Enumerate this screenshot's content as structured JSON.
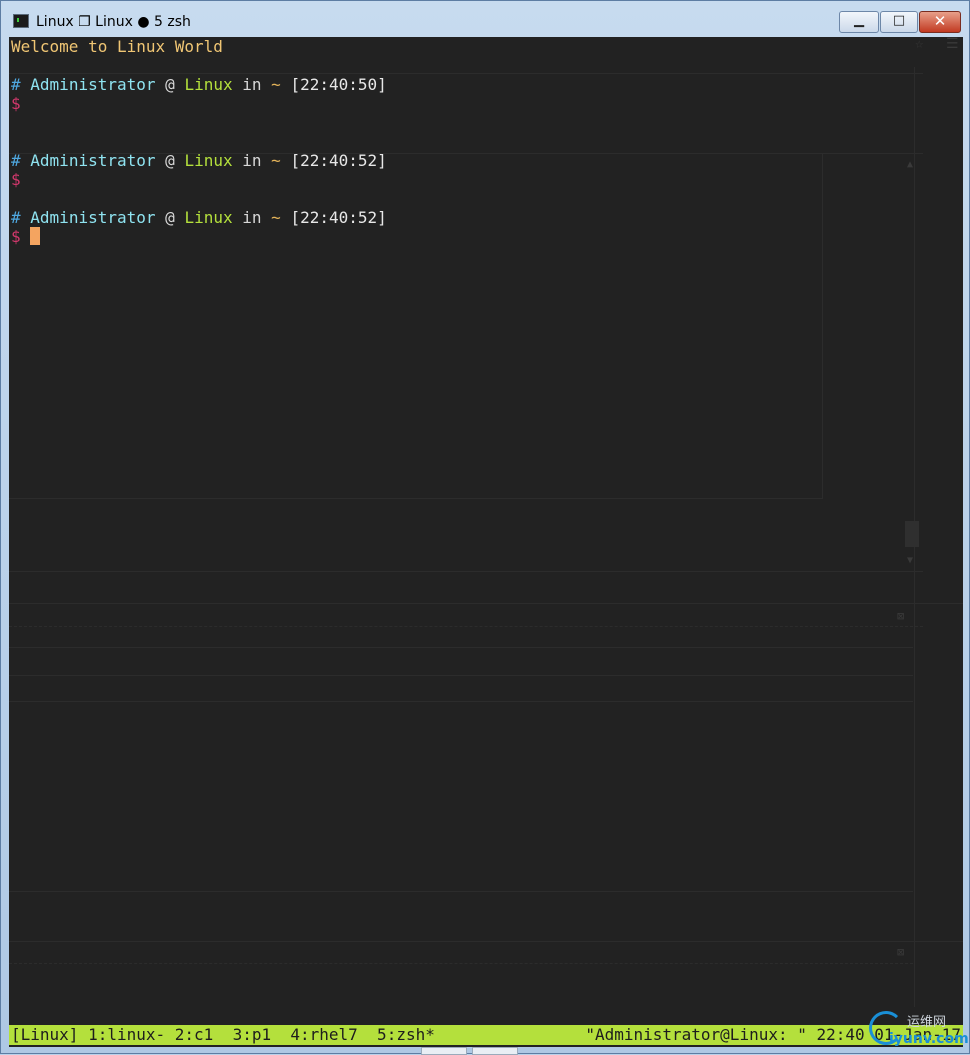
{
  "window": {
    "title": "Linux ❐ Linux ● 5 zsh",
    "controls": {
      "minimize": "▁",
      "maximize": "□",
      "close": "✕"
    }
  },
  "terminal": {
    "welcome": "Welcome to Linux World",
    "prompts": [
      {
        "hash": "#",
        "user": "Administrator",
        "at": "@",
        "host": "Linux",
        "in": "in",
        "dir": "~",
        "time": "[22:40:50]",
        "dollar": "$"
      },
      {
        "hash": "#",
        "user": "Administrator",
        "at": "@",
        "host": "Linux",
        "in": "in",
        "dir": "~",
        "time": "[22:40:52]",
        "dollar": "$"
      },
      {
        "hash": "#",
        "user": "Administrator",
        "at": "@",
        "host": "Linux",
        "in": "in",
        "dir": "~",
        "time": "[22:40:52]",
        "dollar": "$"
      }
    ]
  },
  "statusbar": {
    "session": "[Linux]",
    "windows": " 1:linux- 2:c1  3:p1  4:rhel7  5:zsh*",
    "right": "\"Administrator@Linux: \" 22:40 01-Jan-17"
  },
  "watermark": {
    "top": "运维网",
    "bottom": "iyunv.com"
  },
  "colors": {
    "terminal_bg": "#222222",
    "statusbar_bg": "#b4e03c",
    "welcome": "#f0c674",
    "user": "#8fe3f0",
    "host": "#b4e03c",
    "dollar": "#d2386c",
    "cursor": "#f4a460"
  },
  "icons": [
    "terminal-app-icon",
    "minimize-icon",
    "maximize-icon",
    "close-icon"
  ]
}
